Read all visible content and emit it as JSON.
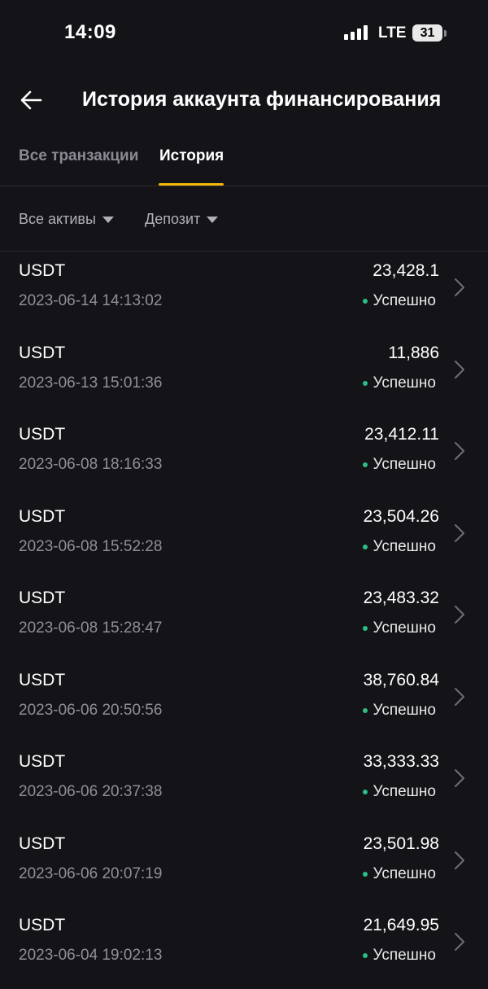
{
  "status_bar": {
    "time": "14:09",
    "network": "LTE",
    "battery": "31"
  },
  "header": {
    "title": "История аккаунта финансирования",
    "back_icon": "arrow-left-icon"
  },
  "tabs": [
    {
      "label": "Все транзакции",
      "active": false
    },
    {
      "label": "История",
      "active": true
    }
  ],
  "filters": {
    "assets": "Все активы",
    "type": "Депозит"
  },
  "colors": {
    "background": "#141318",
    "accent": "#f0b90b",
    "success": "#2ebd85"
  },
  "transactions": [
    {
      "asset": "USDT",
      "datetime": "2023-06-14 14:13:02",
      "amount": "23,428.1",
      "status": "Успешно"
    },
    {
      "asset": "USDT",
      "datetime": "2023-06-13 15:01:36",
      "amount": "11,886",
      "status": "Успешно"
    },
    {
      "asset": "USDT",
      "datetime": "2023-06-08 18:16:33",
      "amount": "23,412.11",
      "status": "Успешно"
    },
    {
      "asset": "USDT",
      "datetime": "2023-06-08 15:52:28",
      "amount": "23,504.26",
      "status": "Успешно"
    },
    {
      "asset": "USDT",
      "datetime": "2023-06-08 15:28:47",
      "amount": "23,483.32",
      "status": "Успешно"
    },
    {
      "asset": "USDT",
      "datetime": "2023-06-06 20:50:56",
      "amount": "38,760.84",
      "status": "Успешно"
    },
    {
      "asset": "USDT",
      "datetime": "2023-06-06 20:37:38",
      "amount": "33,333.33",
      "status": "Успешно"
    },
    {
      "asset": "USDT",
      "datetime": "2023-06-06 20:07:19",
      "amount": "23,501.98",
      "status": "Успешно"
    },
    {
      "asset": "USDT",
      "datetime": "2023-06-04 19:02:13",
      "amount": "21,649.95",
      "status": "Успешно"
    }
  ]
}
